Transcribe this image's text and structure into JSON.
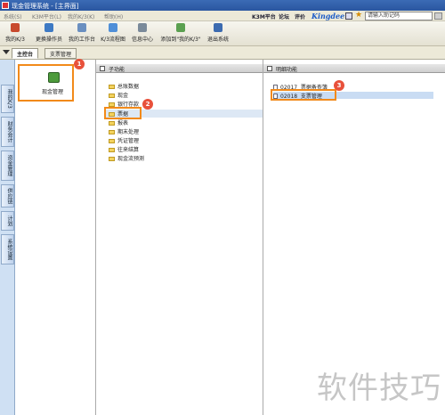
{
  "window": {
    "title": "现金管理系统 - [主界面]"
  },
  "menu": {
    "items": [
      "系统(S)",
      "K3M平台(L)",
      "我的K/3(K)",
      "帮助(H)"
    ],
    "right": {
      "platform": "K3M平台",
      "forum": "论坛",
      "review": "评价",
      "brand": "Kingdee",
      "search_placeholder": "请输入助记码"
    }
  },
  "toolbar": {
    "buttons": [
      {
        "label": "我的K/3",
        "icon": "my-k3-icon",
        "color": "#c84a2e"
      },
      {
        "label": "更换操作员",
        "icon": "switch-user-icon",
        "color": "#3e7ac4"
      },
      {
        "label": "我的工作台",
        "icon": "workbench-icon",
        "color": "#6a8fc0"
      },
      {
        "label": "K/3流程图",
        "icon": "flowchart-icon",
        "color": "#4f8fd8"
      },
      {
        "label": "信息中心",
        "icon": "info-center-icon",
        "color": "#7a8a9a"
      },
      {
        "label": "添加到\"我的K/3\"",
        "icon": "add-favorite-icon",
        "color": "#5aa050"
      },
      {
        "label": "退出系统",
        "icon": "exit-icon",
        "color": "#3c6bb0"
      }
    ]
  },
  "tabs": [
    {
      "label": "主控台",
      "active": true
    },
    {
      "label": "支票管理",
      "active": false
    }
  ],
  "left_sidebar": {
    "items": [
      "我的K/3",
      "财务会计",
      "资金管理",
      "供应链",
      "计划",
      "系统设置"
    ]
  },
  "module_panel": {
    "label": "现金管理"
  },
  "sub_panel": {
    "title": "子功能",
    "items": [
      "总账数据",
      "现金",
      "银行存款",
      "票据",
      "报表",
      "期末处理",
      "凭证管理",
      "往来结算",
      "现金流预测"
    ],
    "selected_index": 3
  },
  "detail_panel": {
    "title": "明细功能",
    "items": [
      {
        "code": "02017",
        "name": "票据备查簿"
      },
      {
        "code": "02018",
        "name": "支票管理"
      }
    ],
    "selected_index": 1
  },
  "annotations": {
    "badges": [
      "1",
      "2",
      "3"
    ],
    "highlight_color": "#f28a1a"
  },
  "watermark": "软件技巧"
}
